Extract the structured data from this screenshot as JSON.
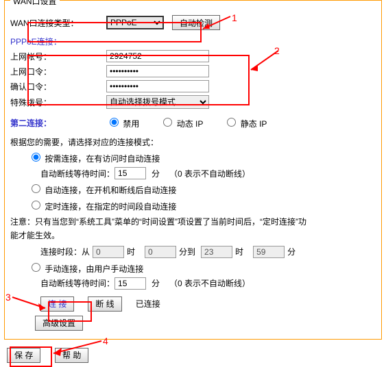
{
  "fieldset_title": "WAN口设置",
  "row_conn_type": {
    "label": "WAN口连接类型：",
    "value": "PPPoE",
    "detect_btn": "自动检测"
  },
  "pppoe_section": "PPPoE连接：",
  "row_account": {
    "label": "上网帐号：",
    "value": "2924752"
  },
  "row_pw1": {
    "label": "上网口令：",
    "value": "••••••••••"
  },
  "row_pw2": {
    "label": "确认口令：",
    "value": "••••••••••"
  },
  "row_special": {
    "label": "特殊拨号：",
    "value": "自动选择拨号模式"
  },
  "second_conn": {
    "label": "第二连接：",
    "disabled": "禁用",
    "dyn": "动态 IP",
    "stat": "静态 IP"
  },
  "mode_hint": "根据您的需要，请选择对应的连接模式：",
  "opt1": {
    "label": "按需连接，在有访问时自动连接",
    "sub_a": "自动断线等待时间：",
    "sub_val": "15",
    "sub_b": "分",
    "sub_c": "（0 表示不自动断线）"
  },
  "opt2": {
    "label": "自动连接，在开机和断线后自动连接"
  },
  "opt3": {
    "label": "定时连接，在指定的时间段自动连接",
    "note": "注意：只有当您到“系统工具”菜单的“时间设置”项设置了当前时间后，“定时连接”功能才能生效。",
    "range_a": "连接时段：从",
    "h1": "0",
    "t1": "时",
    "m1": "0",
    "t2": "分到",
    "h2": "23",
    "t3": "时",
    "m2": "59",
    "t4": "分"
  },
  "opt4": {
    "label": "手动连接，由用户手动连接",
    "sub_a": "自动断线等待时间：",
    "sub_val": "15",
    "sub_b": "分",
    "sub_c": "（0 表示不自动断线）"
  },
  "buttons": {
    "connect": "连 接",
    "disconnect": "断 线",
    "status": "已连接",
    "adv": "高级设置",
    "save": "保 存",
    "help": "帮 助"
  },
  "ann": {
    "1": "1",
    "2": "2",
    "3": "3",
    "4": "4"
  }
}
